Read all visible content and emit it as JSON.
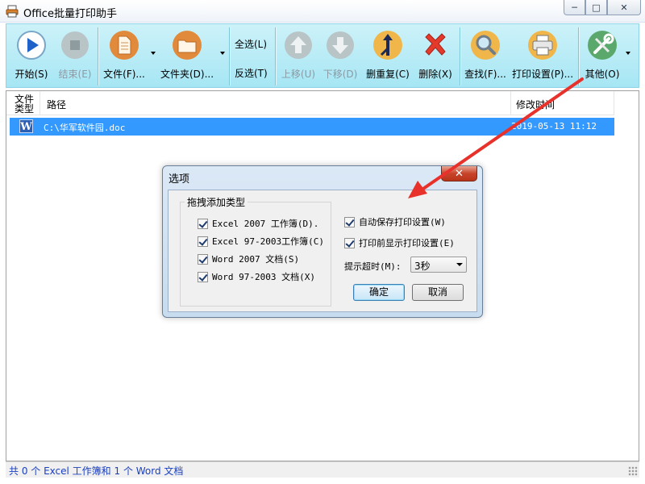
{
  "window": {
    "title": "Office批量打印助手",
    "controls": {
      "minimize": "─",
      "maximize": "□",
      "close": "✕"
    }
  },
  "toolbar": {
    "start": "开始(S)",
    "end": "结束(E)",
    "file": "文件(F)...",
    "folder": "文件夹(D)...",
    "select_all": "全选(L)",
    "invert": "反选(T)",
    "move_up": "上移(U)",
    "move_down": "下移(D)",
    "dedupe": "删重复(C)",
    "delete": "删除(X)",
    "find": "查找(F)...",
    "print_settings": "打印设置(P)...",
    "other": "其他(O)"
  },
  "list": {
    "columns": {
      "type": "文件类型",
      "path": "路径",
      "modified": "修改时间"
    },
    "rows": [
      {
        "type_icon": "word-doc-icon",
        "type_letter": "W",
        "path": "C:\\华军软件园.doc",
        "modified": "2019-05-13 11:12"
      }
    ]
  },
  "status": {
    "text": "共 0 个 Excel 工作簿和 1 个 Word 文档"
  },
  "dialog": {
    "title": "选项",
    "close_label": "✕",
    "group_title": "拖拽添加类型",
    "types": [
      {
        "label": "Excel 2007 工作簿(D).",
        "checked": true
      },
      {
        "label": "Excel 97-2003工作簿(C)",
        "checked": true
      },
      {
        "label": "Word 2007 文档(S)",
        "checked": true
      },
      {
        "label": "Word 97-2003 文档(X)",
        "checked": true
      }
    ],
    "auto_save": {
      "label": "自动保存打印设置(W)",
      "checked": true
    },
    "show_before_print": {
      "label": "打印前显示打印设置(E)",
      "checked": true
    },
    "timeout_label": "提示超时(M):",
    "timeout_value": "3秒",
    "ok": "确定",
    "cancel": "取消"
  },
  "colors": {
    "toolbar_top": "#cdf2f9",
    "toolbar_bottom": "#a6e6f4",
    "selection": "#3399ff",
    "status_text": "#1a3fbf",
    "annotation_arrow": "#e8312a"
  }
}
